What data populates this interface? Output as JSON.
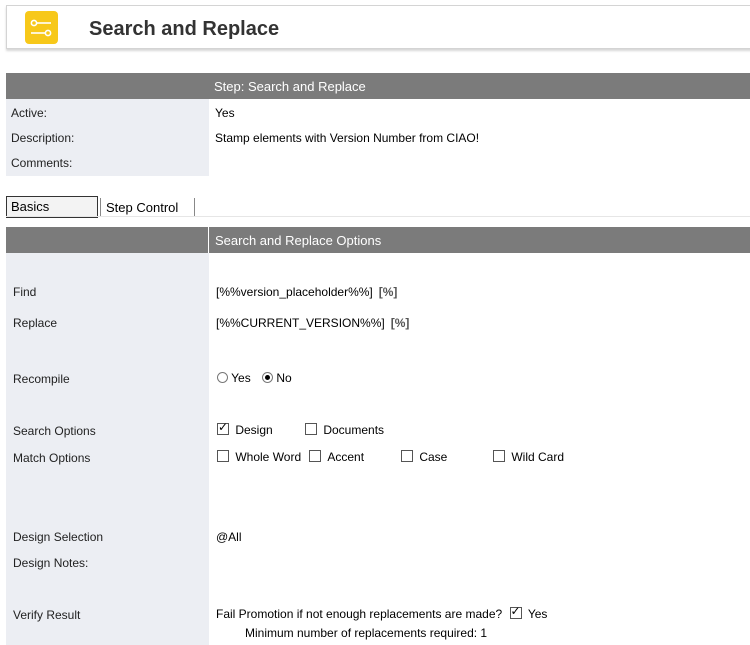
{
  "header": {
    "title": "Search and Replace",
    "icon": "workflow-icon",
    "icon_color": "#f7c81a"
  },
  "step": {
    "bar_label": "Step:  Search and Replace",
    "fields": [
      {
        "label": "Active:",
        "value": "Yes"
      },
      {
        "label": "Description:",
        "value": "Stamp elements with Version Number from CIAO!"
      },
      {
        "label": "Comments:",
        "value": ""
      }
    ]
  },
  "tabs": [
    {
      "label": "Basics",
      "selected": true
    },
    {
      "label": "Step Control",
      "selected": false
    }
  ],
  "options": {
    "bar_label": "Search and Replace Options",
    "find": {
      "label": "Find",
      "value": "[%%version_placeholder%%]",
      "button": "[%]"
    },
    "replace": {
      "label": "Replace",
      "value": "[%%CURRENT_VERSION%%]",
      "button": "[%]"
    },
    "recompile": {
      "label": "Recompile",
      "options": [
        "Yes",
        "No"
      ],
      "selected": "No"
    },
    "search_options": {
      "label": "Search Options",
      "items": [
        {
          "label": "Design",
          "checked": true
        },
        {
          "label": "Documents",
          "checked": false
        }
      ]
    },
    "match_options": {
      "label": "Match Options",
      "items": [
        {
          "label": "Whole Word",
          "checked": false
        },
        {
          "label": "Accent",
          "checked": false
        },
        {
          "label": "Case",
          "checked": false
        },
        {
          "label": "Wild Card",
          "checked": false
        }
      ]
    },
    "design_selection": {
      "label": "Design Selection",
      "value": "@All"
    },
    "design_notes": {
      "label": "Design Notes:",
      "value": ""
    },
    "verify": {
      "label": "Verify Result",
      "question": "Fail Promotion if not enough replacements are made?",
      "checked": true,
      "answer": "Yes",
      "minimum_text": "Minimum number of replacements required: 1"
    }
  }
}
